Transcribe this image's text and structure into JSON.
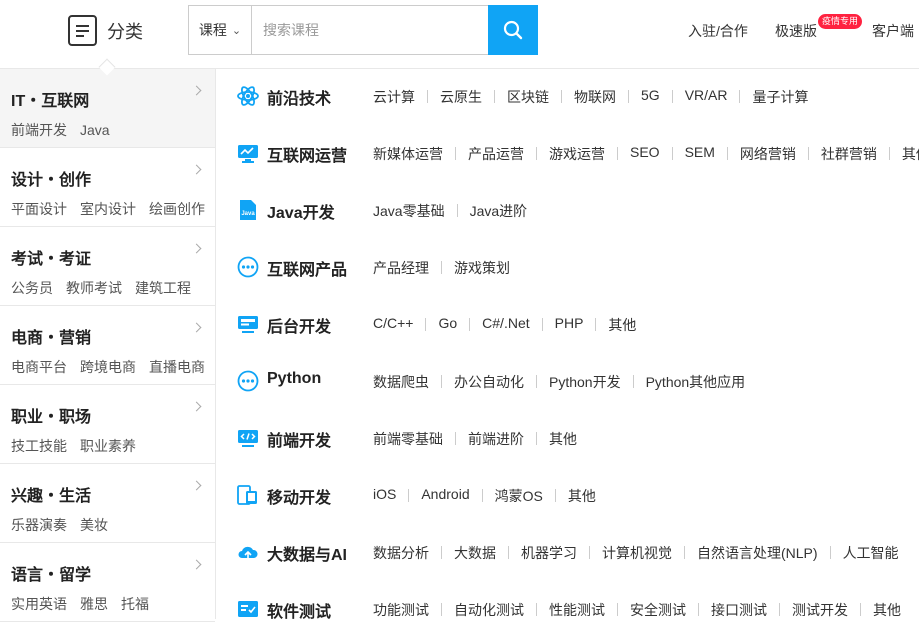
{
  "header": {
    "category_label": "分类",
    "search_type": "课程",
    "search_placeholder": "搜索课程",
    "nav_join": "入驻/合作",
    "nav_fast": "极速版",
    "nav_fast_badge": "疫情专用",
    "nav_client": "客户端"
  },
  "colors": {
    "accent": "#10a4f5",
    "badge": "#ff2240"
  },
  "sidebar": {
    "items": [
      {
        "title": "IT・互联网",
        "subs": [
          "前端开发",
          "Java"
        ],
        "active": true
      },
      {
        "title": "设计・创作",
        "subs": [
          "平面设计",
          "室内设计",
          "绘画创作"
        ]
      },
      {
        "title": "考试・考证",
        "subs": [
          "公务员",
          "教师考试",
          "建筑工程"
        ]
      },
      {
        "title": "电商・营销",
        "subs": [
          "电商平台",
          "跨境电商",
          "直播电商"
        ]
      },
      {
        "title": "职业・职场",
        "subs": [
          "技工技能",
          "职业素养"
        ]
      },
      {
        "title": "兴趣・生活",
        "subs": [
          "乐器演奏",
          "美妆"
        ]
      },
      {
        "title": "语言・留学",
        "subs": [
          "实用英语",
          "雅思",
          "托福"
        ]
      }
    ]
  },
  "main": {
    "rows": [
      {
        "icon": "atom-icon",
        "title": "前沿技术",
        "links": [
          "云计算",
          "云原生",
          "区块链",
          "物联网",
          "5G",
          "VR/AR",
          "量子计算"
        ]
      },
      {
        "icon": "monitor-chart-icon",
        "title": "互联网运营",
        "links": [
          "新媒体运营",
          "产品运营",
          "游戏运营",
          "SEO",
          "SEM",
          "网络营销",
          "社群营销",
          "其他"
        ]
      },
      {
        "icon": "java-file-icon",
        "title": "Java开发",
        "links": [
          "Java零基础",
          "Java进阶"
        ]
      },
      {
        "icon": "dots-circle-icon",
        "title": "互联网产品",
        "links": [
          "产品经理",
          "游戏策划"
        ]
      },
      {
        "icon": "server-monitor-icon",
        "title": "后台开发",
        "links": [
          "C/C++",
          "Go",
          "C#/.Net",
          "PHP",
          "其他"
        ]
      },
      {
        "icon": "dots-circle-icon",
        "title": "Python",
        "links": [
          "数据爬虫",
          "办公自动化",
          "Python开发",
          "Python其他应用"
        ]
      },
      {
        "icon": "code-monitor-icon",
        "title": "前端开发",
        "links": [
          "前端零基础",
          "前端进阶",
          "其他"
        ]
      },
      {
        "icon": "mobile-devices-icon",
        "title": "移动开发",
        "links": [
          "iOS",
          "Android",
          "鸿蒙OS",
          "其他"
        ]
      },
      {
        "icon": "cloud-upload-icon",
        "title": "大数据与AI",
        "links": [
          "数据分析",
          "大数据",
          "机器学习",
          "计算机视觉",
          "自然语言处理(NLP)",
          "人工智能"
        ]
      },
      {
        "icon": "test-report-icon",
        "title": "软件测试",
        "links": [
          "功能测试",
          "自动化测试",
          "性能测试",
          "安全测试",
          "接口测试",
          "测试开发",
          "其他"
        ]
      }
    ]
  }
}
